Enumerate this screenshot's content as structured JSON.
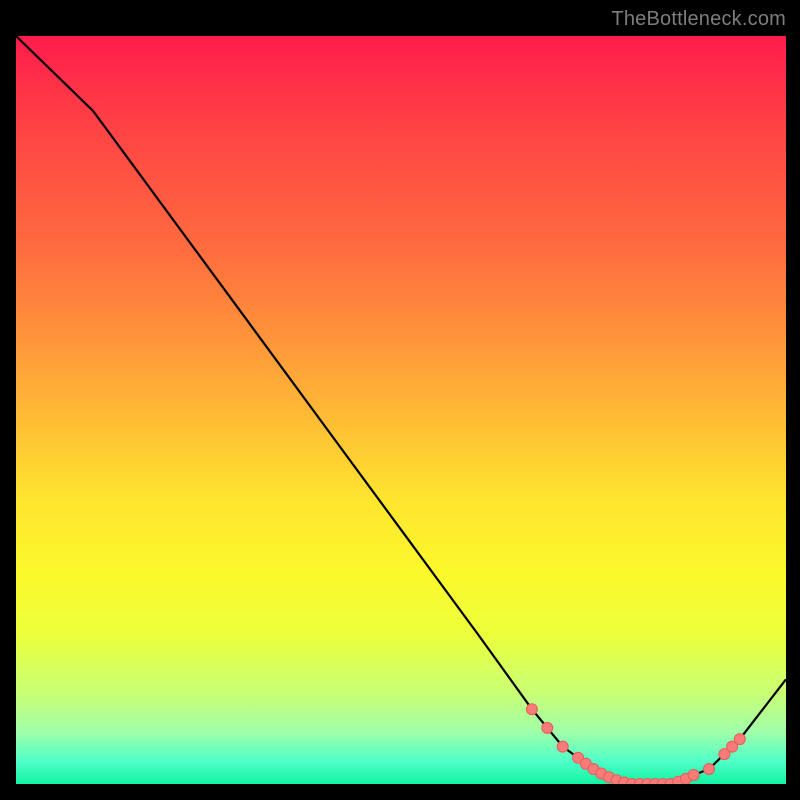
{
  "watermark": "TheBottleneck.com",
  "colors": {
    "frame": "#000000",
    "curve": "#000000",
    "marker_fill": "#f77b79",
    "marker_stroke": "#ea5c59",
    "gradient_top": "#ff1c4c",
    "gradient_bottom": "#11f3a2"
  },
  "chart_data": {
    "type": "line",
    "title": "",
    "xlabel": "",
    "ylabel": "",
    "xlim": [
      0,
      100
    ],
    "ylim": [
      0,
      100
    ],
    "grid": false,
    "series": [
      {
        "name": "bottleneck-curve",
        "x": [
          0,
          4,
          10,
          20,
          30,
          40,
          50,
          60,
          67,
          71,
          75,
          80,
          85,
          90,
          94,
          100
        ],
        "values": [
          100,
          96,
          90,
          76,
          62,
          48,
          34,
          20,
          10,
          5,
          2,
          0,
          0,
          2,
          6,
          14
        ]
      }
    ],
    "markers": {
      "name": "highlight-dots",
      "x": [
        67,
        69,
        71,
        73,
        74,
        75,
        76,
        77,
        78,
        79,
        80,
        81,
        82,
        83,
        84,
        85,
        86,
        87,
        88,
        90,
        92,
        93,
        94
      ],
      "values": [
        10,
        7.5,
        5,
        3.5,
        2.7,
        2,
        1.4,
        0.9,
        0.5,
        0.2,
        0,
        0,
        0,
        0,
        0,
        0,
        0.3,
        0.7,
        1.2,
        2,
        4,
        5,
        6
      ]
    }
  }
}
